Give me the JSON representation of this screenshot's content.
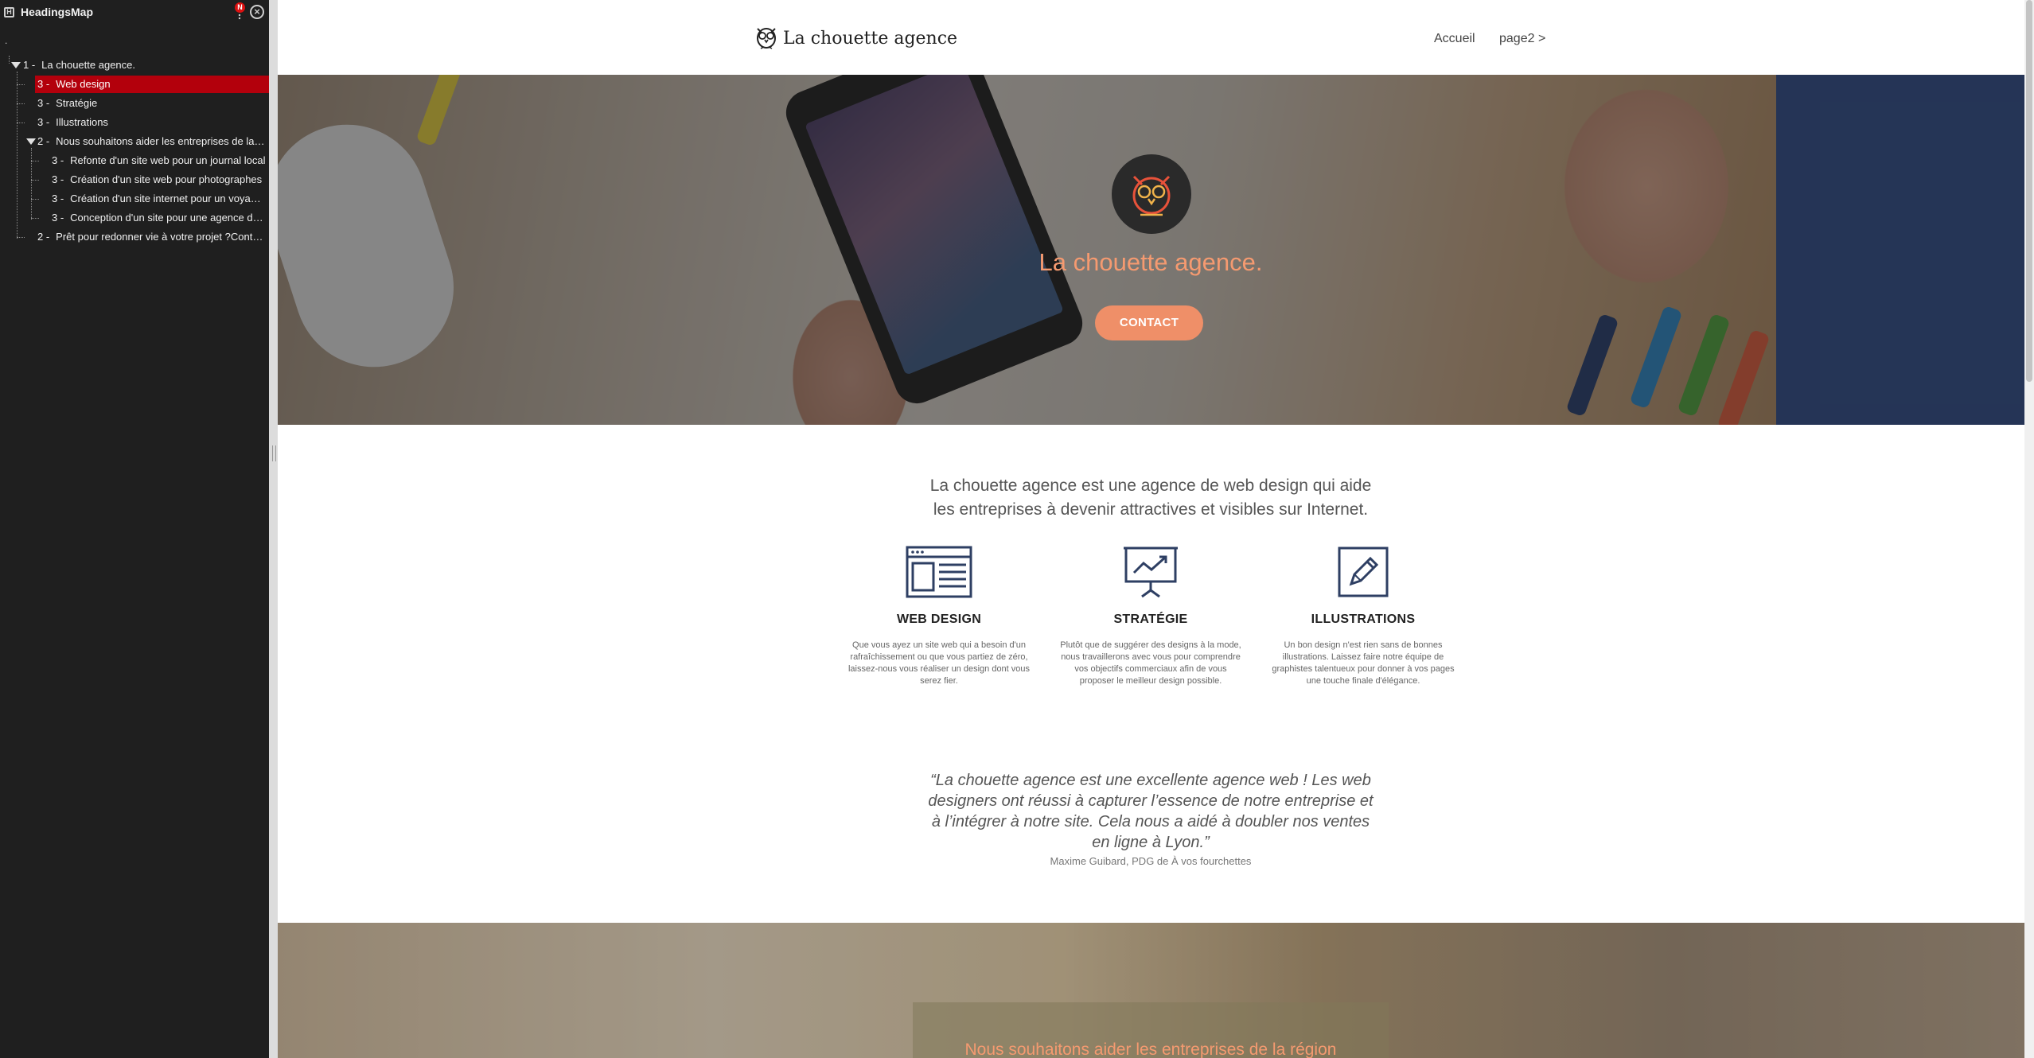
{
  "headingsmap": {
    "title": "HeadingsMap",
    "badge": "N",
    "root": ".",
    "items": [
      {
        "level": "1 -",
        "text": "La chouette agence."
      },
      {
        "level": "3 -",
        "text": "Web design"
      },
      {
        "level": "3 -",
        "text": "Stratégie"
      },
      {
        "level": "3 -",
        "text": "Illustrations"
      },
      {
        "level": "2 -",
        "text": "Nous souhaitons aider les entreprises de la région"
      },
      {
        "level": "3 -",
        "text": "Refonte d'un site web pour un journal local"
      },
      {
        "level": "3 -",
        "text": "Création d'un site web pour photographes"
      },
      {
        "level": "3 -",
        "text": "Création d'un site internet pour un voyagiste"
      },
      {
        "level": "3 -",
        "text": "Conception d'un site pour une agence de voyage"
      },
      {
        "level": "2 -",
        "text": "Prêt pour redonner vie à votre projet ?Contactez-nous"
      }
    ]
  },
  "site": {
    "brand": "La chouette agence",
    "nav": {
      "home": "Accueil",
      "page2": "page2 >"
    },
    "hero": {
      "title": "La chouette agence.",
      "button": "CONTACT"
    },
    "intro_line1": "La chouette agence est une agence de web design qui aide",
    "intro_line2": "les entreprises à devenir attractives et visibles sur Internet.",
    "features": [
      {
        "icon": "browser-window-icon",
        "title": "WEB DESIGN",
        "text": "Que vous ayez un site web qui a besoin d'un rafraîchissement ou que vous partiez de zéro, laissez-nous vous réaliser un design dont vous serez fier."
      },
      {
        "icon": "presentation-chart-icon",
        "title": "STRATÉGIE",
        "text": "Plutôt que de suggérer des designs à la mode, nous travaillerons avec vous pour comprendre vos objectifs commerciaux afin de vous proposer le meilleur design possible."
      },
      {
        "icon": "pencil-square-icon",
        "title": "ILLUSTRATIONS",
        "text": "Un bon design n'est rien sans de bonnes illustrations. Laissez faire notre équipe de graphistes talentueux pour donner à vos pages une touche finale d'élégance."
      }
    ],
    "quote": "“La chouette agence est une excellente agence web ! Les web designers ont réussi à capturer l’essence de notre entreprise et à l’intégrer à notre site. Cela nous a aidé à doubler nos ventes en ligne à Lyon.”",
    "quote_author": "Maxime Guibard, PDG de À vos fourchettes",
    "band_title": "Nous souhaitons aider les entreprises de la région"
  },
  "colors": {
    "panel_bg": "#1f1f1f",
    "active_item": "#b3000c",
    "accent": "#ef8f68",
    "hero_title": "#f59a70",
    "icon_navy": "#2e3f63"
  }
}
